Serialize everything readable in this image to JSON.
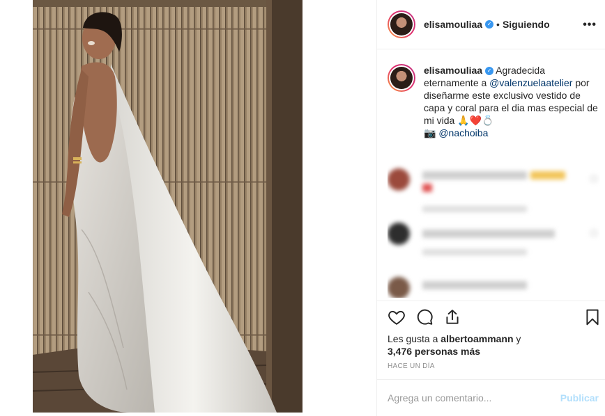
{
  "post": {
    "username": "elisamouliaa",
    "follow_status": "Siguiendo",
    "separator": "•",
    "more_label": "•••"
  },
  "caption": {
    "username": "elisamouliaa",
    "text_1": "Agradecida eternamente a ",
    "mention_1": "@valenzuelaatelier",
    "text_2": " por diseñarme este exclusivo vestido de capa y coral para el dia mas especial de mi vida ",
    "emojis": "🙏❤️💍",
    "camera": "📷",
    "mention_2": "@nachoiba"
  },
  "likes": {
    "prefix": "Les gusta a ",
    "user": "albertoammann",
    "connector": " y",
    "count_text": "3,476 personas más"
  },
  "timestamp": "HACE UN DÍA",
  "comment_box": {
    "placeholder": "Agrega un comentario...",
    "publish_label": "Publicar"
  },
  "icons": {
    "verified": "verified-badge-icon",
    "like": "heart-icon",
    "comment": "comment-icon",
    "share": "share-icon",
    "save": "bookmark-icon"
  },
  "colors": {
    "link": "#003569",
    "verified": "#3897f0",
    "publish_disabled": "#b2dffc",
    "muted": "#8e8e8e"
  }
}
